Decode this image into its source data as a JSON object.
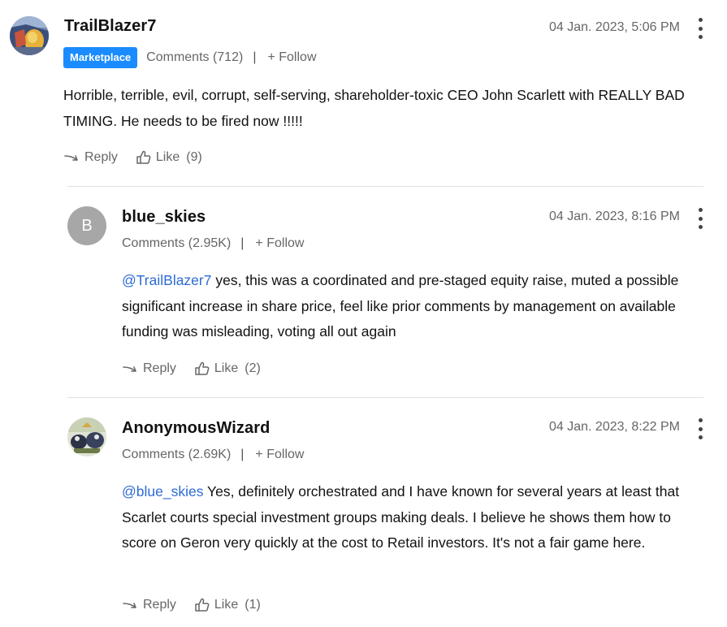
{
  "comments": [
    {
      "username": "TrailBlazer7",
      "badge": "Marketplace",
      "comments_label": "Comments (712)",
      "separator": "|",
      "follow_label": "+ Follow",
      "timestamp": "04 Jan. 2023, 5:06 PM",
      "mention": "",
      "text": "Horrible, terrible, evil, corrupt, self-serving, shareholder-toxic CEO John Scarlett with REALLY BAD TIMING. He needs to be fired now !!!!!",
      "reply_label": "Reply",
      "like_label": "Like",
      "like_count": "(9)"
    },
    {
      "username": "blue_skies",
      "avatar_letter": "B",
      "comments_label": "Comments (2.95K)",
      "separator": "|",
      "follow_label": "+ Follow",
      "timestamp": "04 Jan. 2023, 8:16 PM",
      "mention": "@TrailBlazer7",
      "text": " yes, this was a coordinated and pre-staged equity raise, muted a possible significant increase in share price, feel like prior comments by management on available funding was misleading, voting all out again",
      "reply_label": "Reply",
      "like_label": "Like",
      "like_count": "(2)"
    },
    {
      "username": "AnonymousWizard",
      "comments_label": "Comments (2.69K)",
      "separator": "|",
      "follow_label": "+ Follow",
      "timestamp": "04 Jan. 2023, 8:22 PM",
      "mention": "@blue_skies",
      "text": " Yes, definitely orchestrated and I have known for several years at least that Scarlet courts special investment groups making deals. I believe he shows them how to score on Geron very quickly at the cost to Retail investors. It's not a fair game here.",
      "reply_label": "Reply",
      "like_label": "Like",
      "like_count": "(1)"
    }
  ],
  "colors": {
    "badge": "#1a8cff",
    "mention": "#2d6bd4",
    "meta_text": "#666666",
    "avatar_letter_bg": "#a7a7a7"
  },
  "icons": {
    "reply": "reply-arrow-icon",
    "like": "thumbs-up-icon",
    "menu": "more-vertical-icon"
  }
}
